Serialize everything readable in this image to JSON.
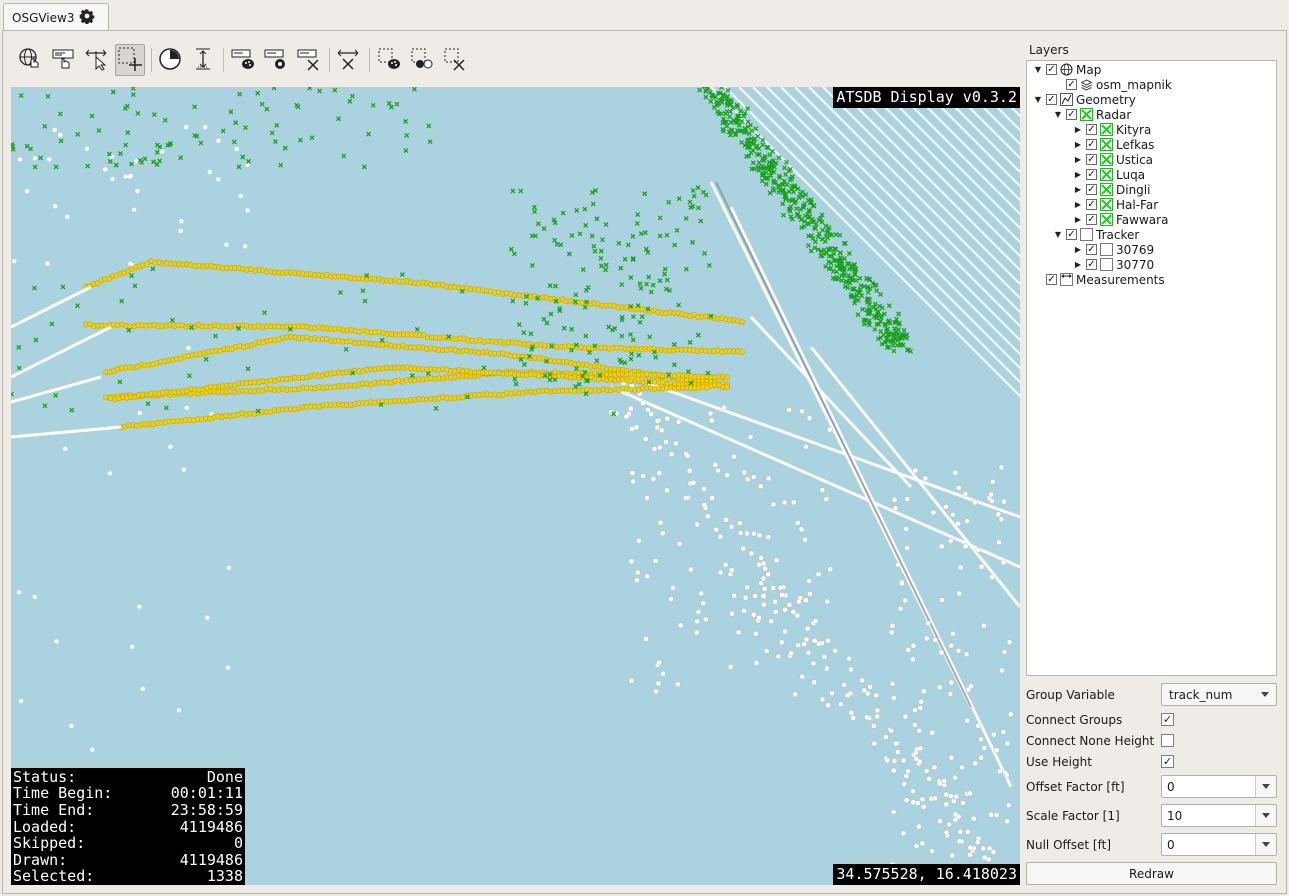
{
  "tab": {
    "label": "OSGView3",
    "icon": "gear-icon"
  },
  "toolbar": {
    "buttons": [
      {
        "name": "navigate-map-button",
        "icon": "globe-hand-icon"
      },
      {
        "name": "label-select-button",
        "icon": "label-hand-icon"
      },
      {
        "name": "measure-distance-button",
        "icon": "arrow-cursor-icon"
      },
      {
        "name": "select-add-button",
        "icon": "selection-plus-icon",
        "active": true
      },
      {
        "name": "time-filter-button",
        "icon": "clock-icon"
      },
      {
        "name": "height-filter-button",
        "icon": "height-icon"
      },
      {
        "name": "label-style-button",
        "icon": "label-palette-icon"
      },
      {
        "name": "label-settings-button",
        "icon": "label-gear-icon"
      },
      {
        "name": "label-clear-button",
        "icon": "label-x-icon"
      },
      {
        "name": "measure-clear-button",
        "icon": "arrow-x-icon"
      },
      {
        "name": "selection-style-button",
        "icon": "selection-palette-icon"
      },
      {
        "name": "selection-invert-button",
        "icon": "selection-invert-icon"
      },
      {
        "name": "selection-clear-button",
        "icon": "selection-x-icon"
      }
    ]
  },
  "map": {
    "version": "ATSDB Display v0.3.2",
    "coordinates": "34.575528, 16.418023",
    "stats": [
      {
        "label": "Status:",
        "value": "Done"
      },
      {
        "label": "Time Begin:",
        "value": "00:01:11"
      },
      {
        "label": "Time End:",
        "value": "23:58:59"
      },
      {
        "label": "Loaded:",
        "value": "4119486"
      },
      {
        "label": "Skipped:",
        "value": "0"
      },
      {
        "label": "Drawn:",
        "value": "4119486"
      },
      {
        "label": "Selected:",
        "value": "1338"
      }
    ],
    "colors": {
      "water": "#aad3df",
      "selected": "#f2d000",
      "radar": "#1aa01a",
      "track": "#ffffff"
    }
  },
  "layers": {
    "title": "Layers",
    "items": [
      {
        "label": "Map",
        "level": 0,
        "expanded": true,
        "checked": true,
        "icon": "globe-icon"
      },
      {
        "label": "osm_mapnik",
        "level": 1,
        "expanded": null,
        "checked": true,
        "icon": "layers-icon"
      },
      {
        "label": "Geometry",
        "level": 0,
        "expanded": true,
        "checked": true,
        "icon": "geometry-icon"
      },
      {
        "label": "Radar",
        "level": 1,
        "expanded": true,
        "checked": true,
        "icon": "radar-cross-icon"
      },
      {
        "label": "Kityra",
        "level": 2,
        "expanded": false,
        "checked": true,
        "icon": "radar-cross-icon"
      },
      {
        "label": "Lefkas",
        "level": 2,
        "expanded": false,
        "checked": true,
        "icon": "radar-cross-icon"
      },
      {
        "label": "Ustica",
        "level": 2,
        "expanded": false,
        "checked": true,
        "icon": "radar-cross-icon"
      },
      {
        "label": "Luqa",
        "level": 2,
        "expanded": false,
        "checked": true,
        "icon": "radar-cross-icon"
      },
      {
        "label": "Dingli",
        "level": 2,
        "expanded": false,
        "checked": true,
        "icon": "radar-cross-icon"
      },
      {
        "label": "Hal-Far",
        "level": 2,
        "expanded": false,
        "checked": true,
        "icon": "radar-cross-icon"
      },
      {
        "label": "Fawwara",
        "level": 2,
        "expanded": false,
        "checked": true,
        "icon": "radar-cross-icon"
      },
      {
        "label": "Tracker",
        "level": 1,
        "expanded": true,
        "checked": true,
        "icon": "white-square-icon"
      },
      {
        "label": "30769",
        "level": 2,
        "expanded": false,
        "checked": true,
        "icon": "white-square-icon"
      },
      {
        "label": "30770",
        "level": 2,
        "expanded": false,
        "checked": true,
        "icon": "white-square-icon"
      },
      {
        "label": "Measurements",
        "level": 0,
        "expanded": null,
        "checked": true,
        "icon": "measure-icon"
      }
    ]
  },
  "settings": {
    "group_variable": {
      "label": "Group Variable",
      "value": "track_num"
    },
    "connect_groups": {
      "label": "Connect Groups",
      "checked": true
    },
    "connect_none_height": {
      "label": "Connect None Height",
      "checked": false
    },
    "use_height": {
      "label": "Use Height",
      "checked": true
    },
    "offset_factor": {
      "label": "Offset Factor [ft]",
      "value": "0"
    },
    "scale_factor": {
      "label": "Scale Factor [1]",
      "value": "10"
    },
    "null_offset": {
      "label": "Null Offset [ft]",
      "value": "0"
    },
    "redraw_label": "Redraw"
  }
}
